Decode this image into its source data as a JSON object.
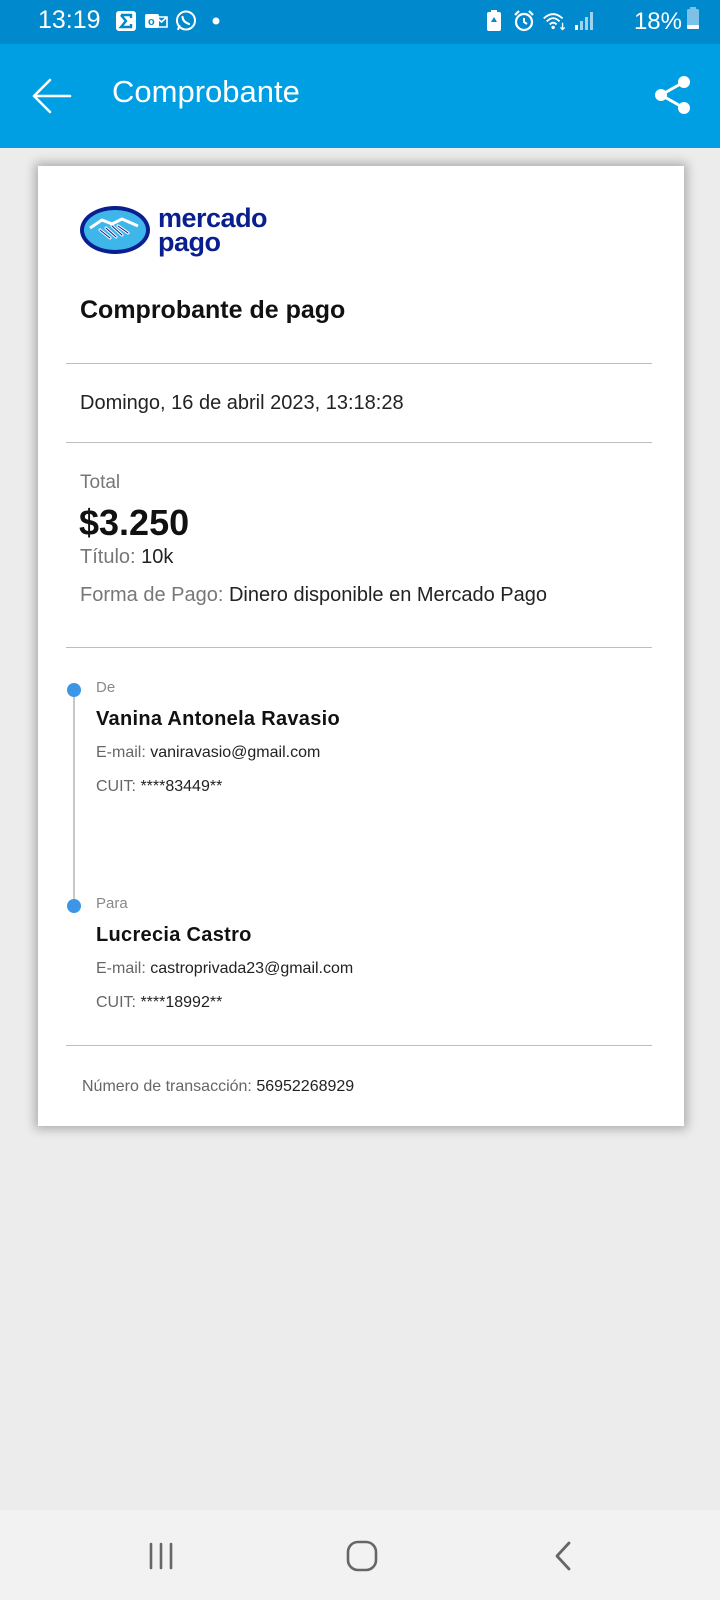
{
  "status_bar": {
    "time": "13:19",
    "battery_percent": "18%",
    "left_icons": [
      "sigma-app-icon",
      "outlook-icon",
      "whatsapp-icon",
      "notification-dot-icon"
    ],
    "right_icons": [
      "battery-saver-icon",
      "alarm-icon",
      "wifi-icon",
      "signal-icon"
    ]
  },
  "app_bar": {
    "title": "Comprobante",
    "color": "#009ee3"
  },
  "receipt": {
    "logo_line1": "mercado",
    "logo_line2": "pago",
    "title": "Comprobante de pago",
    "date": "Domingo, 16 de abril 2023, 13:18:28",
    "total_label": "Total",
    "total_amount": "$3.250",
    "titulo_label": "Título:",
    "titulo_value": "10k",
    "forma_label": "Forma de Pago:",
    "forma_value": "Dinero disponible en Mercado Pago",
    "from": {
      "tag": "De",
      "name": "Vanina Antonela Ravasio",
      "email_label": "E-mail:",
      "email": "vaniravasio@gmail.com",
      "cuit_label": "CUIT:",
      "cuit": "****83449**"
    },
    "to": {
      "tag": "Para",
      "name": "Lucrecia Castro",
      "email_label": "E-mail:",
      "email": "castroprivada23@gmail.com",
      "cuit_label": "CUIT:",
      "cuit": "****18992**"
    },
    "transaction_label": "Número de transacción:",
    "transaction_number": "56952268929"
  }
}
